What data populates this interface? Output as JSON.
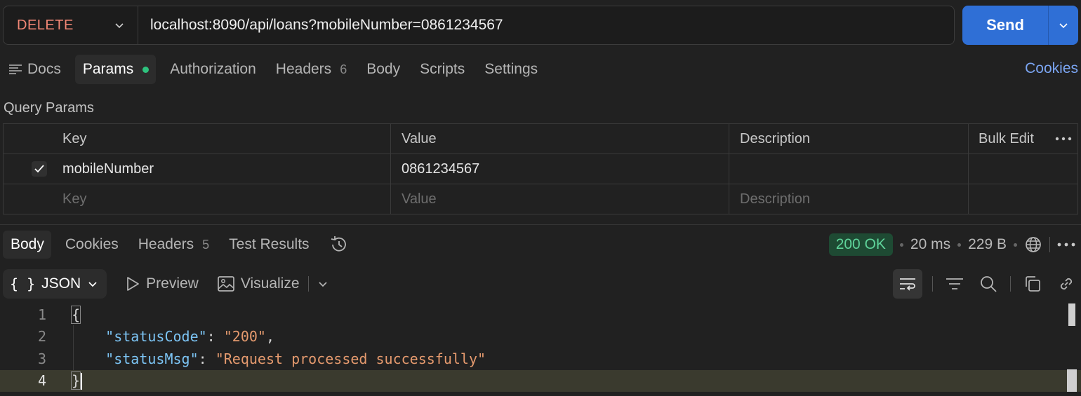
{
  "request": {
    "method": "DELETE",
    "url": "localhost:8090/api/loans?mobileNumber=0861234567",
    "send_label": "Send"
  },
  "req_tabs": [
    {
      "label": "Docs"
    },
    {
      "label": "Params"
    },
    {
      "label": "Authorization"
    },
    {
      "label": "Headers",
      "count": "6"
    },
    {
      "label": "Body"
    },
    {
      "label": "Scripts"
    },
    {
      "label": "Settings"
    }
  ],
  "cookies_label": "Cookies",
  "query_params": {
    "section_label": "Query Params",
    "headers": {
      "key": "Key",
      "value": "Value",
      "description": "Description",
      "bulk_edit": "Bulk Edit"
    },
    "rows": [
      {
        "key": "mobileNumber",
        "value": "0861234567",
        "description": ""
      }
    ],
    "placeholders": {
      "key": "Key",
      "value": "Value",
      "description": "Description"
    }
  },
  "resp_tabs": [
    {
      "label": "Body"
    },
    {
      "label": "Cookies"
    },
    {
      "label": "Headers",
      "count": "5"
    },
    {
      "label": "Test Results"
    }
  ],
  "response": {
    "status": "200 OK",
    "time": "20 ms",
    "size": "229 B",
    "colors": {
      "status_bg": "#1e4a33",
      "status_text": "#5fd39a",
      "accent": "#2f6fd6"
    }
  },
  "viewer": {
    "format": "JSON",
    "preview": "Preview",
    "visualize": "Visualize"
  },
  "code": {
    "line_numbers": [
      "1",
      "2",
      "3",
      "4"
    ],
    "open_brace": "{",
    "close_brace": "}",
    "pairs": [
      {
        "key": "\"statusCode\"",
        "value": "\"200\"",
        "trail": ","
      },
      {
        "key": "\"statusMsg\"",
        "value": "\"Request processed successfully\"",
        "trail": ""
      }
    ]
  }
}
